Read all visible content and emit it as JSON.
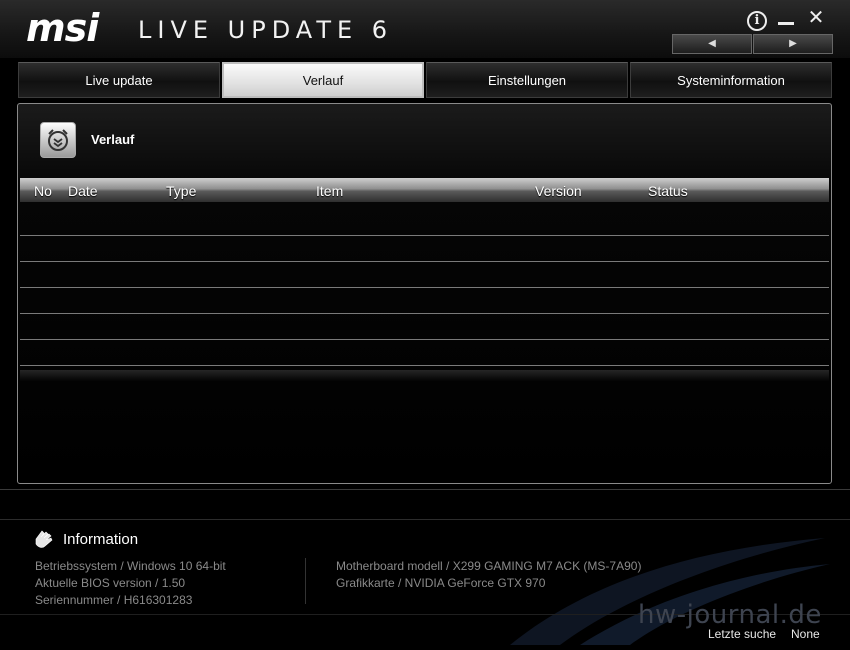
{
  "window": {
    "brand": "msi",
    "product": "LIVE UPDATE 6"
  },
  "window_controls": {
    "info_icon": "info-circle-icon",
    "minimize_icon": "minimize-icon",
    "close_symbol": "✕"
  },
  "nav": {
    "prev_symbol": "◀",
    "next_symbol": "▶"
  },
  "tabs": [
    {
      "label": "Live update",
      "active": false
    },
    {
      "label": "Verlauf",
      "active": true
    },
    {
      "label": "Einstellungen",
      "active": false
    },
    {
      "label": "Systeminformation",
      "active": false
    }
  ],
  "history": {
    "title": "Verlauf",
    "icon": "history-icon",
    "columns": [
      "No",
      "Date",
      "Type",
      "Item",
      "Version",
      "Status"
    ],
    "rows": []
  },
  "information": {
    "title": "Information",
    "icon": "hand-icon",
    "os": "Betriebssystem / Windows 10 64-bit",
    "bios": "Aktuelle BIOS version / 1.50",
    "serial": "Seriennummer / H616301283",
    "motherboard": "Motherboard modell / X299 GAMING M7 ACK (MS-7A90)",
    "graphics": "Grafikkarte / NVIDIA GeForce GTX 970"
  },
  "footer": {
    "watermark": "hw-journal.de",
    "last_search_label": "Letzte suche",
    "last_search_value": "None"
  },
  "colors": {
    "background": "#000000",
    "tab_active": "#e8e8e8",
    "muted_text": "#8a8a8a"
  }
}
